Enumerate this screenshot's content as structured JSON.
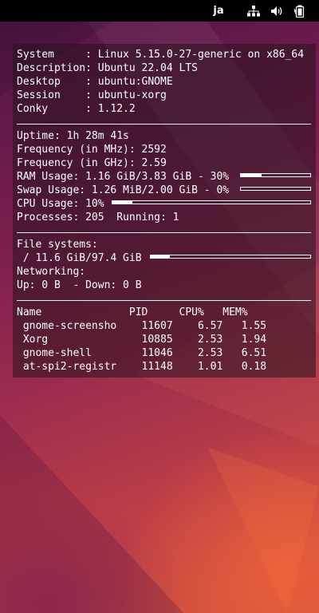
{
  "topbar": {
    "lang": "ja"
  },
  "system": [
    "System     : Linux 5.15.0-27-generic on x86_64",
    "Description: Ubuntu 22.04 LTS",
    "Desktop    : ubuntu:GNOME",
    "Session    : ubuntu-xorg",
    "Conky      : 1.12.2"
  ],
  "stats": {
    "uptime": "Uptime: 1h 28m 41s",
    "freq_mhz": "Frequency (in MHz): 2592",
    "freq_ghz": "Frequency (in GHz): 2.59",
    "ram": "RAM Usage: 1.16 GiB/3.83 GiB - 30%",
    "ram_fraction": 0.3,
    "swap": "Swap Usage: 1.26 MiB/2.00 GiB - 0%",
    "swap_fraction": 0.0,
    "cpu": "CPU Usage: 10%",
    "cpu_fraction": 0.1,
    "processes": "Processes: 205  Running: 1"
  },
  "filesystems": {
    "header": "File systems:",
    "root": " / 11.6 GiB/97.4 GiB",
    "root_fraction": 0.12
  },
  "networking": {
    "header": "Networking:",
    "line": "Up: 0 B  - Down: 0 B"
  },
  "processes": {
    "header": "Name              PID     CPU%   MEM%",
    "rows": [
      " gnome-screensho    11607    6.57   1.55",
      " Xorg               10885    2.53   1.94",
      " gnome-shell        11046    2.53   6.51",
      " at-spi2-registr    11148    1.01   0.18"
    ]
  }
}
